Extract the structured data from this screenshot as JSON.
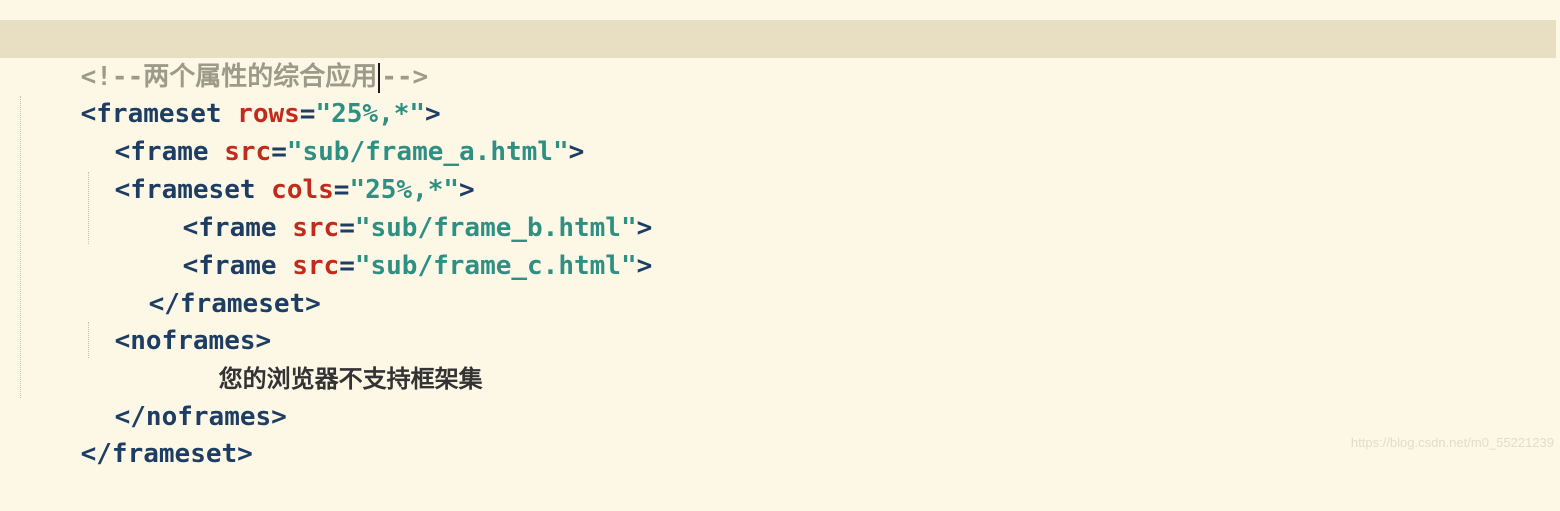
{
  "editor": {
    "lines": {
      "l1": {
        "comment_start": "<!--两个属性的综合应用",
        "comment_end": "-->"
      },
      "l2": {
        "open": "<",
        "tag": "frameset",
        "attr": "rows",
        "eq": "=",
        "value": "\"25%,*\"",
        "close": ">"
      },
      "l3": {
        "open": "<",
        "tag": "frame",
        "attr": "src",
        "eq": "=",
        "value": "\"sub/frame_a.html\"",
        "close": ">"
      },
      "l4": {
        "open": "<",
        "tag": "frameset",
        "attr": "cols",
        "eq": "=",
        "value": "\"25%,*\"",
        "close": ">"
      },
      "l5": {
        "open": "<",
        "tag": "frame",
        "attr": "src",
        "eq": "=",
        "value": "\"sub/frame_b.html\"",
        "close": ">"
      },
      "l6": {
        "open": "<",
        "tag": "frame",
        "attr": "src",
        "eq": "=",
        "value": "\"sub/frame_c.html\"",
        "close": ">"
      },
      "l7": {
        "text": "</frameset>"
      },
      "l8": {
        "text": "<noframes>"
      },
      "l9": {
        "text": "您的浏览器不支持框架集"
      },
      "l10": {
        "text": "</noframes>"
      },
      "l11": {
        "text": "</frameset>"
      }
    }
  },
  "watermark": "https://blog.csdn.net/m0_55221239",
  "colors": {
    "background": "#fdf7e6",
    "highlight_line": "#e8dfc2",
    "tag": "#1d3d63",
    "attribute": "#c22b1b",
    "string": "#2e8f83",
    "comment": "#9c9a88"
  }
}
